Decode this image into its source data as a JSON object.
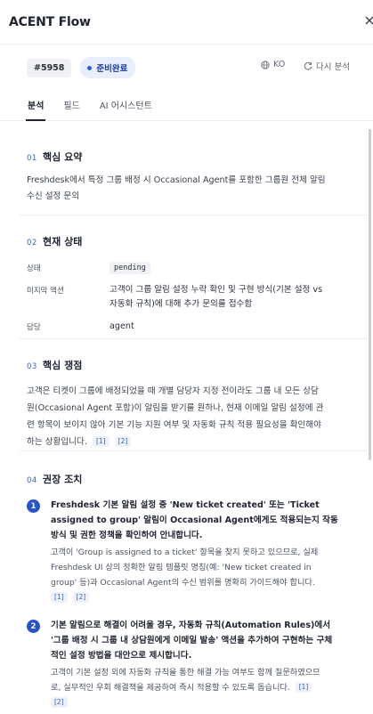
{
  "app": {
    "title": "ACENT Flow"
  },
  "meta": {
    "ticket_id": "#5958",
    "status_label": "준비완료",
    "language_label": "KO",
    "reanalyze_label": "다시 분석"
  },
  "tabs": [
    {
      "label": "분석",
      "active": true
    },
    {
      "label": "필드",
      "active": false
    },
    {
      "label": "AI 어시스턴트",
      "active": false
    }
  ],
  "sections": {
    "summary": {
      "number": "01",
      "title": "핵심 요약",
      "lines": [
        "Freshdesk에서 특정 그룹 배정 시 Occasional Agent를 포함한 그룹원 전체 알림",
        "수신 설정 문의"
      ]
    },
    "status": {
      "number": "02",
      "title": "현재 상태",
      "state_key": "상태",
      "state_value": "pending",
      "pending_key": "미지막 액션",
      "pending_lines": [
        "고객이 그룹 알림 설정 누락 확인 및 구현 방식(기본 설정 vs",
        "자동화 규칙)에 대해 추가 문의를 접수함"
      ],
      "owner_key": "담당",
      "owner_value": "agent"
    },
    "issue": {
      "number": "03",
      "title": "핵심 쟁점",
      "lines": [
        "고객은 티켓이 그룹에 배정되었을 때 개별 담당자 지정 전이라도 그룹 내 모든 상담",
        "원(Occasional Agent 포함)이 알림을 받기를 원하나, 현재 이메일 알림 설정에 관",
        "련 항목이 보이지 않아 기본 기능 지원 여부 및 자동화 규칙 적용 필요성을 확인해야",
        "하는 상황입니다."
      ],
      "refs": [
        "[1]",
        "[2]"
      ]
    },
    "actions": {
      "number": "04",
      "title": "권장 조치",
      "items": [
        {
          "index": "1",
          "title_lines": [
            "Freshdesk 기본 알림 설정 중 'New ticket created' 또는 'Ticket",
            "assigned to group' 알림이 Occasional Agent에게도 적용되는지 작동",
            "방식 및 권한 정책을 확인하여 안내합니다."
          ],
          "desc_lines": [
            "고객이 'Group is assigned to a ticket' 항목을 찾지 못하고 있으므로, 실제",
            "Freshdesk UI 상의 정확한 알림 템플릿 명칭(예: 'New ticket created in",
            "group' 등)과 Occasional Agent의 수신 범위를 명확히 가이드해야 합니다."
          ],
          "refs": [
            "[1]",
            "[2]"
          ]
        },
        {
          "index": "2",
          "title_lines": [
            "기본 알림으로 해결이 어려울 경우, 자동화 규칙(Automation Rules)에서",
            "'그룹 배정 시 그룹 내 상담원에게 이메일 발송' 액션을 추가하여 구현하는 구체",
            "적인 설정 방법을 대안으로 제시합니다."
          ],
          "desc_lines": [
            "고객이 기본 설정 외에 자동화 규칙을 통한 해결 가능 여부도 함께 질문하였으므",
            "로, 실무적인 우회 해결책을 제공하여 즉시 적용할 수 있도록 돕습니다."
          ],
          "refs": [
            "[1]",
            "[2]"
          ]
        }
      ]
    }
  }
}
